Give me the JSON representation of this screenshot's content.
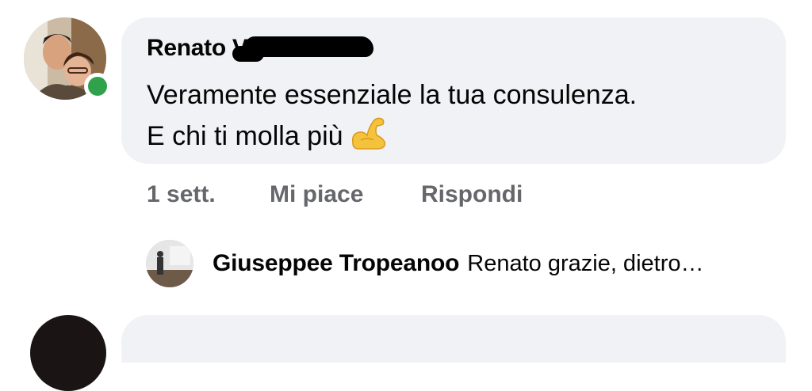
{
  "comment": {
    "author": "Renato V",
    "text_line1": "Veramente essenziale la tua consulenza.",
    "text_line2": "E chi ti molla più",
    "emoji": "flexed-biceps-icon",
    "online": true
  },
  "actions": {
    "time": "1 sett.",
    "like_label": "Mi piace",
    "reply_label": "Rispondi"
  },
  "reply": {
    "author": "Giuseppee Tropeanoo",
    "snippet": "Renato grazie, dietro…"
  },
  "colors": {
    "bubble": "#f0f2f5",
    "text": "#050505",
    "secondary_text": "#65676b",
    "online_dot": "#31a24c"
  }
}
